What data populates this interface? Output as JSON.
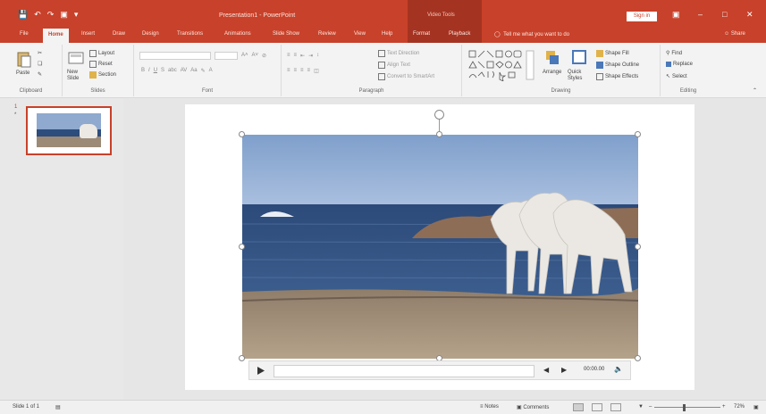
{
  "titlebar": {
    "document_title": "Presentation1 - PowerPoint",
    "context_label": "Video Tools",
    "signin_label": "Sign in",
    "qat_save_icon": "save-icon",
    "qat_undo_icon": "undo-icon",
    "qat_redo_icon": "redo-icon"
  },
  "tabs": {
    "file": "File",
    "home": "Home",
    "insert": "Insert",
    "draw": "Draw",
    "design": "Design",
    "transitions": "Transitions",
    "animations": "Animations",
    "slideshow": "Slide Show",
    "review": "Review",
    "view": "View",
    "help": "Help",
    "format": "Format",
    "playback": "Playback",
    "tellme": "Tell me what you want to do",
    "share": "Share"
  },
  "ribbon": {
    "clipboard": {
      "paste": "Paste",
      "label": "Clipboard"
    },
    "slides": {
      "new_slide": "New Slide",
      "layout": "Layout",
      "reset": "Reset",
      "section": "Section",
      "label": "Slides"
    },
    "font": {
      "label": "Font"
    },
    "paragraph": {
      "text_direction": "Text Direction",
      "align_text": "Align Text",
      "convert_smartart": "Convert to SmartArt",
      "label": "Paragraph"
    },
    "drawing": {
      "arrange": "Arrange",
      "quick_styles": "Quick Styles",
      "shape_fill": "Shape Fill",
      "shape_outline": "Shape Outline",
      "shape_effects": "Shape Effects",
      "label": "Drawing"
    },
    "editing": {
      "find": "Find",
      "replace": "Replace",
      "select": "Select",
      "label": "Editing"
    }
  },
  "thumbnails": [
    {
      "number": "1",
      "marker": "*"
    }
  ],
  "media": {
    "timecode": "00:00.00",
    "progress": 0
  },
  "statusbar": {
    "slide_info": "Slide 1 of 1",
    "notes": "Notes",
    "comments": "Comments",
    "zoom": "72%"
  },
  "colors": {
    "accent": "#c8412a",
    "context_band": "#a53321",
    "ribbon_bg": "#f3f3f3",
    "workspace_bg": "#e6e6e6"
  }
}
